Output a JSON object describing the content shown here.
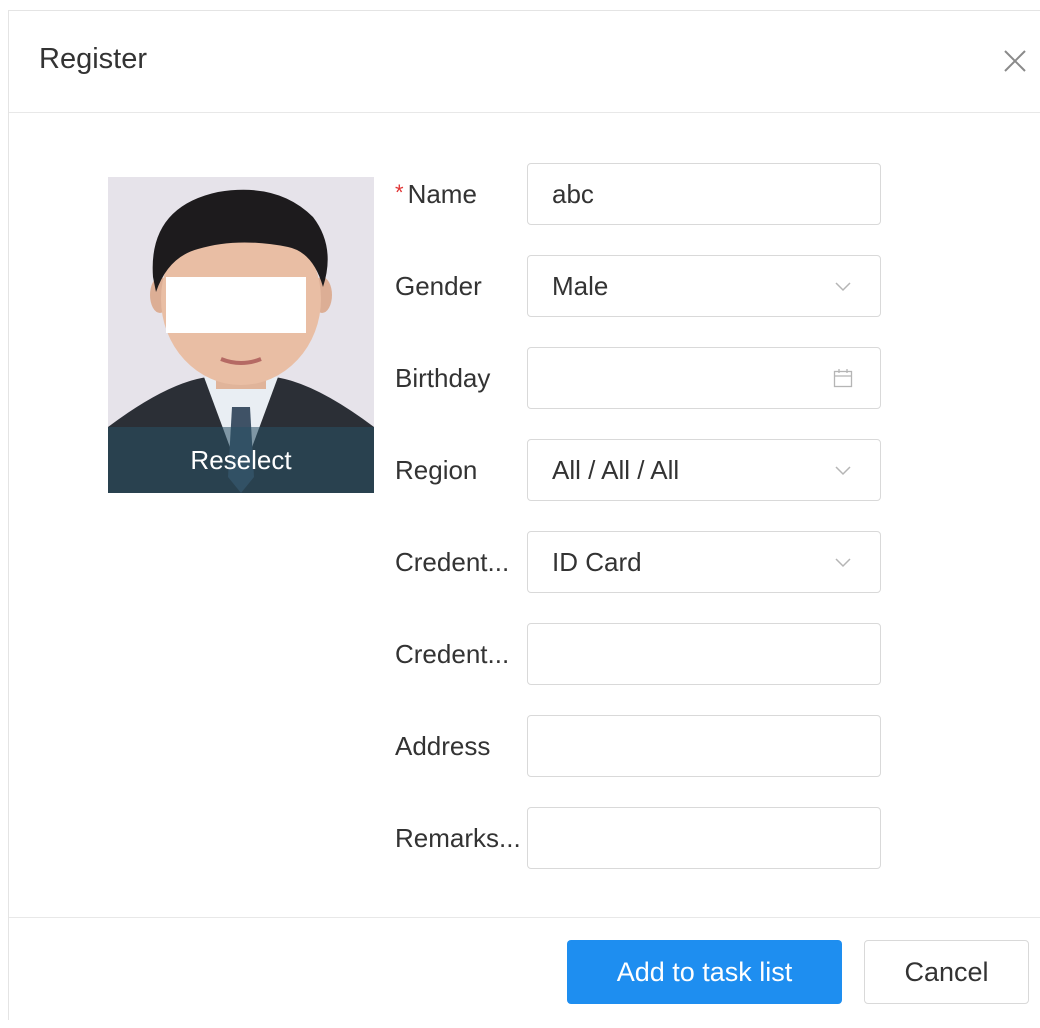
{
  "dialog": {
    "title": "Register",
    "close_icon": "close-icon"
  },
  "photo": {
    "reselect_label": "Reselect"
  },
  "form": {
    "required_mark": "*",
    "name": {
      "label": "Name",
      "value": "abc"
    },
    "gender": {
      "label": "Gender",
      "value": "Male",
      "icon": "chevron-down-icon"
    },
    "birthday": {
      "label": "Birthday",
      "value": "",
      "icon": "calendar-icon"
    },
    "region": {
      "label": "Region",
      "value": "All / All / All",
      "icon": "chevron-down-icon"
    },
    "credential_type": {
      "label": "Credent...",
      "value": "ID Card",
      "icon": "chevron-down-icon"
    },
    "credential_no": {
      "label": "Credent...",
      "value": ""
    },
    "address": {
      "label": "Address",
      "value": ""
    },
    "remarks": {
      "label": "Remarks...",
      "value": ""
    }
  },
  "footer": {
    "add_label": "Add to task list",
    "cancel_label": "Cancel"
  },
  "colors": {
    "primary": "#1e8ef0",
    "required": "#e03434",
    "border": "#d9d9d9"
  }
}
